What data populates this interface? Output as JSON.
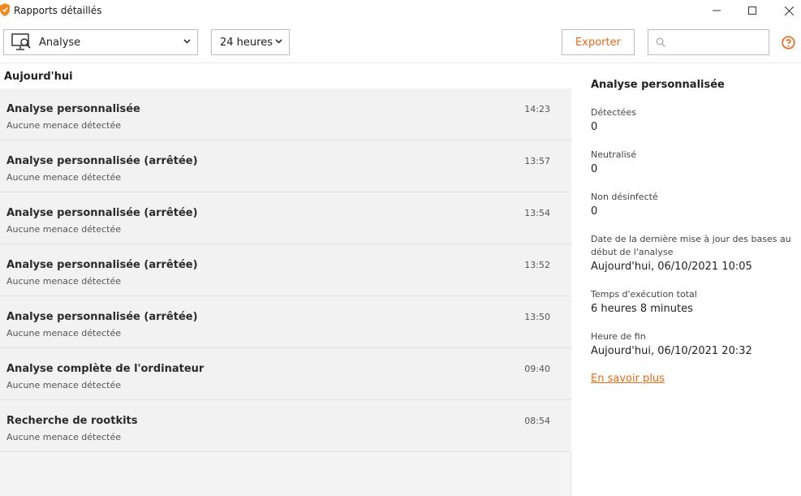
{
  "window": {
    "title": "Rapports détaillés",
    "brand_color": "#f08a1c"
  },
  "toolbar": {
    "report_type": {
      "selected": "Analyse",
      "icon": "monitor-scan-icon"
    },
    "period": {
      "selected": "24 heures"
    },
    "export_label": "Exporter",
    "search": {
      "value": "",
      "placeholder": ""
    },
    "help_icon": "help-icon",
    "accent_color": "#e86a16"
  },
  "list": {
    "section_title": "Aujourd'hui",
    "items": [
      {
        "title": "Analyse personnalisée",
        "status": "Aucune menace détectée",
        "time": "14:23"
      },
      {
        "title": "Analyse personnalisée (arrêtée)",
        "status": "Aucune menace détectée",
        "time": "13:57"
      },
      {
        "title": "Analyse personnalisée (arrêtée)",
        "status": "Aucune menace détectée",
        "time": "13:54"
      },
      {
        "title": "Analyse personnalisée (arrêtée)",
        "status": "Aucune menace détectée",
        "time": "13:52"
      },
      {
        "title": "Analyse personnalisée (arrêtée)",
        "status": "Aucune menace détectée",
        "time": "13:50"
      },
      {
        "title": "Analyse complète de l'ordinateur",
        "status": "Aucune menace détectée",
        "time": "09:40"
      },
      {
        "title": "Recherche de rootkits",
        "status": "Aucune menace détectée",
        "time": "08:54"
      }
    ]
  },
  "details": {
    "title": "Analyse personnalisée",
    "fields": [
      {
        "label": "Détectées",
        "value": "0"
      },
      {
        "label": "Neutralisé",
        "value": "0"
      },
      {
        "label": "Non désinfecté",
        "value": "0"
      },
      {
        "label": "Date de la dernière mise à jour des bases au début de l'analyse",
        "value": "Aujourd'hui, 06/10/2021 10:05"
      },
      {
        "label": "Temps d'exécution total",
        "value": "6 heures 8 minutes"
      },
      {
        "label": "Heure de fin",
        "value": "Aujourd'hui, 06/10/2021 20:32"
      }
    ],
    "learn_more": "En savoir plus"
  }
}
